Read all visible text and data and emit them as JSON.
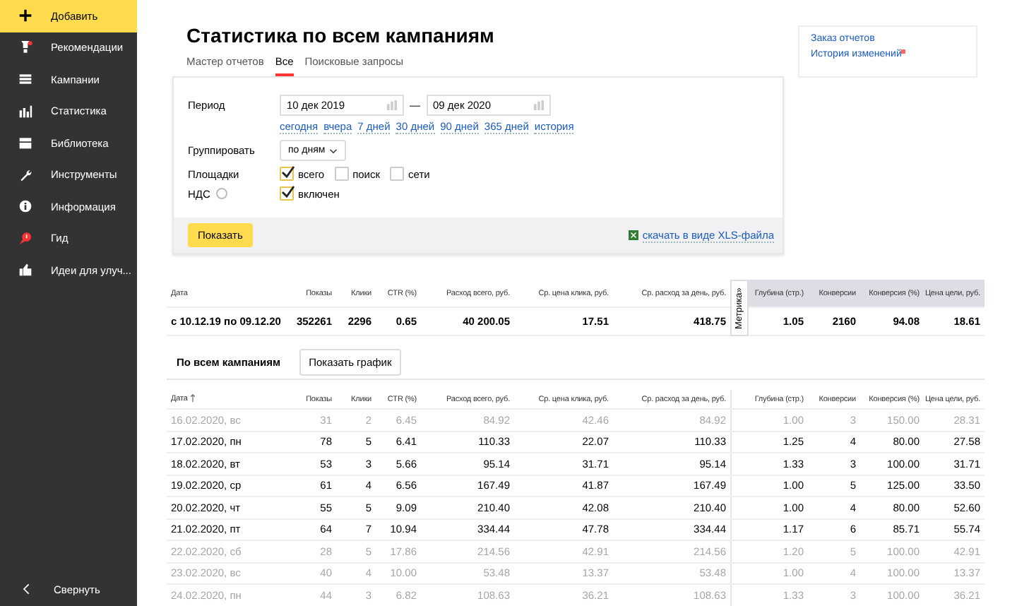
{
  "sidebar": {
    "items": [
      {
        "label": "Добавить",
        "selected": true
      },
      {
        "label": "Рекомендации",
        "selected": false
      },
      {
        "label": "Кампании",
        "selected": false
      },
      {
        "label": "Статистика",
        "selected": false
      },
      {
        "label": "Библиотека",
        "selected": false
      },
      {
        "label": "Инструменты",
        "selected": false
      },
      {
        "label": "Информация",
        "selected": false
      },
      {
        "label": "Гид",
        "selected": false
      },
      {
        "label": "Идеи для улуч...",
        "selected": false
      }
    ],
    "collapse": "Свернуть"
  },
  "title": "Статистика по всем кампаниям",
  "tabs": [
    {
      "label": "Мастер отчетов",
      "selected": false
    },
    {
      "label": "Все",
      "selected": true
    },
    {
      "label": "Поисковые запросы",
      "selected": false
    }
  ],
  "filter": {
    "period_label": "Период",
    "date_from": "10 дек 2019",
    "date_to": "09 дек 2020",
    "dash": "—",
    "presets": [
      "сегодня",
      "вчера",
      "7 дней",
      "30 дней",
      "90 дней",
      "365 дней",
      "история"
    ],
    "group_label": "Группировать",
    "group_value": "по дням",
    "sites_label": "Площадки",
    "sites": [
      {
        "label": "всего",
        "checked": true
      },
      {
        "label": "поиск",
        "checked": false
      },
      {
        "label": "сети",
        "checked": false
      }
    ],
    "vat_label": "НДС",
    "vat": {
      "label": "включен",
      "checked": true
    },
    "show_button": "Показать",
    "xls_link": "скачать в виде XLS-файла"
  },
  "side_links": [
    "Заказ отчетов",
    "История изменений"
  ],
  "summary": {
    "columns": [
      "Дата",
      "Показы",
      "Клики",
      "CTR (%)",
      "Расход всего, руб.",
      "Ср. цена клика, руб.",
      "Ср. расход за день, руб.",
      "Глубина (стр.)",
      "Конверсии",
      "Конверсия (%)",
      "Цена цели, руб."
    ],
    "metrika_tab": "Метрика»",
    "row": [
      "с 10.12.19 по 09.12.20",
      "352261",
      "2296",
      "0.65",
      "40 200.05",
      "17.51",
      "418.75",
      "1.05",
      "2160",
      "94.08",
      "18.61"
    ]
  },
  "daily": {
    "section_title": "По всем кампаниям",
    "chart_button": "Показать график",
    "columns": [
      {
        "label": "Дата",
        "sorted": true
      },
      {
        "label": "Показы",
        "sorted": false
      },
      {
        "label": "Клики",
        "sorted": false
      },
      {
        "label": "CTR (%)",
        "sorted": false
      },
      {
        "label": "Расход всего, руб.",
        "sorted": false
      },
      {
        "label": "Ср. цена клика, руб.",
        "sorted": false
      },
      {
        "label": "Ср. расход за день, руб.",
        "sorted": false
      },
      {
        "label": "Глубина (стр.)",
        "sorted": false
      },
      {
        "label": "Конверсии",
        "sorted": false
      },
      {
        "label": "Конверсия (%)",
        "sorted": false
      },
      {
        "label": "Цена цели, руб.",
        "sorted": false
      }
    ],
    "rows": [
      {
        "dimmed": true,
        "cells": [
          "16.02.2020, вс",
          "31",
          "2",
          "6.45",
          "84.92",
          "42.46",
          "84.92",
          "1.00",
          "3",
          "150.00",
          "28.31"
        ]
      },
      {
        "dimmed": false,
        "cells": [
          "17.02.2020, пн",
          "78",
          "5",
          "6.41",
          "110.33",
          "22.07",
          "110.33",
          "1.25",
          "4",
          "80.00",
          "27.58"
        ]
      },
      {
        "dimmed": false,
        "cells": [
          "18.02.2020, вт",
          "53",
          "3",
          "5.66",
          "95.14",
          "31.71",
          "95.14",
          "1.33",
          "3",
          "100.00",
          "31.71"
        ]
      },
      {
        "dimmed": false,
        "cells": [
          "19.02.2020, ср",
          "61",
          "4",
          "6.56",
          "167.49",
          "41.87",
          "167.49",
          "1.00",
          "5",
          "125.00",
          "33.50"
        ]
      },
      {
        "dimmed": false,
        "cells": [
          "20.02.2020, чт",
          "55",
          "5",
          "9.09",
          "210.40",
          "42.08",
          "210.40",
          "1.00",
          "4",
          "80.00",
          "52.60"
        ]
      },
      {
        "dimmed": false,
        "cells": [
          "21.02.2020, пт",
          "64",
          "7",
          "10.94",
          "334.44",
          "47.78",
          "334.44",
          "1.17",
          "6",
          "85.71",
          "55.74"
        ]
      },
      {
        "dimmed": true,
        "cells": [
          "22.02.2020, сб",
          "28",
          "5",
          "17.86",
          "214.56",
          "42.91",
          "214.56",
          "1.20",
          "5",
          "100.00",
          "42.91"
        ]
      },
      {
        "dimmed": true,
        "cells": [
          "23.02.2020, вс",
          "40",
          "4",
          "10.00",
          "53.48",
          "13.37",
          "53.48",
          "1.00",
          "4",
          "100.00",
          "13.37"
        ]
      },
      {
        "dimmed": true,
        "cells": [
          "24.02.2020, пн",
          "44",
          "3",
          "6.82",
          "108.63",
          "36.21",
          "108.63",
          "1.33",
          "3",
          "100.00",
          "36.21"
        ]
      }
    ]
  }
}
